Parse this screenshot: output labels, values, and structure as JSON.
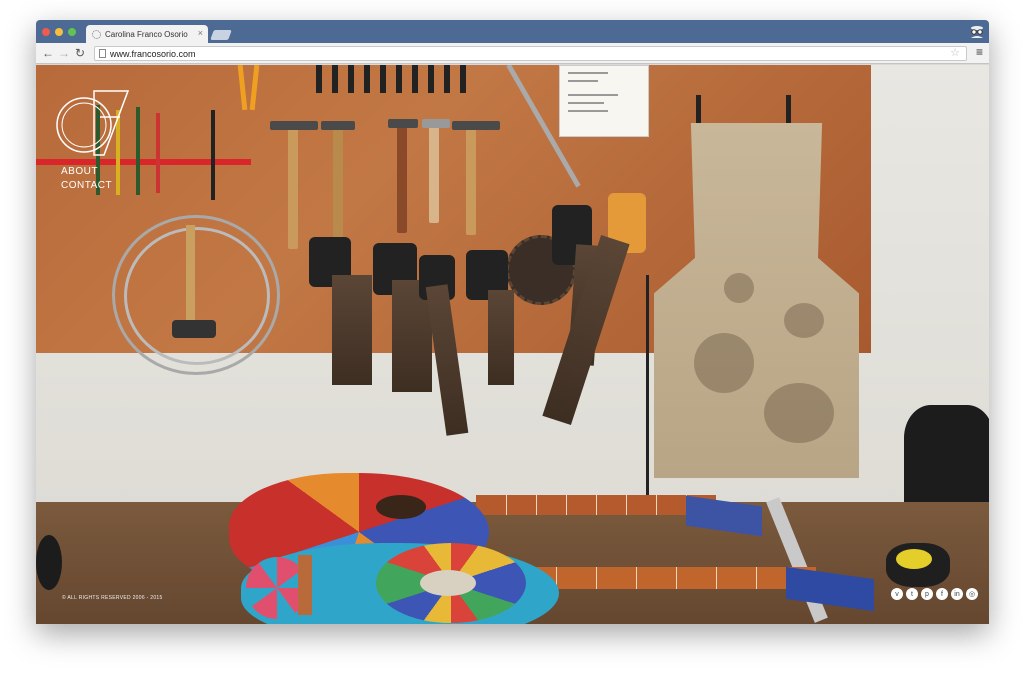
{
  "browser": {
    "tab_title": "Carolina Franco Osorio",
    "tab_close": "×",
    "url": "www.francosorio.com",
    "back_symbol": "←",
    "forward_symbol": "→",
    "reload_symbol": "↻",
    "star_symbol": "☆",
    "menu_symbol": "≡"
  },
  "site": {
    "nav": [
      "ABOUT",
      "CONTACT"
    ],
    "copyright": "© ALL RIGHTS RESERVED 2006 - 2015",
    "social_icons": [
      {
        "name": "vimeo-icon",
        "glyph": "v"
      },
      {
        "name": "twitter-icon",
        "glyph": "t"
      },
      {
        "name": "pinterest-icon",
        "glyph": "p"
      },
      {
        "name": "facebook-icon",
        "glyph": "f"
      },
      {
        "name": "linkedin-icon",
        "glyph": "in"
      },
      {
        "name": "instagram-icon",
        "glyph": "◎"
      }
    ]
  },
  "colors": {
    "tabbar": "#4c6a94",
    "traffic_red": "#ee5b50",
    "traffic_yellow": "#f5be3c",
    "traffic_green": "#5fc454"
  }
}
